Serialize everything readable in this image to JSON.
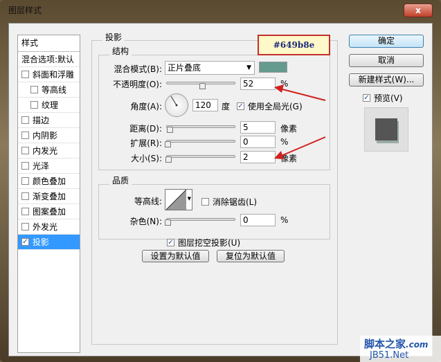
{
  "window": {
    "title": "图层样式",
    "close": "x"
  },
  "sidebar": {
    "header": "样式",
    "items": [
      {
        "label": "混合选项:默认",
        "checkbox": false
      },
      {
        "label": "斜面和浮雕",
        "checkbox": true,
        "checked": false
      },
      {
        "label": "等高线",
        "checkbox": true,
        "checked": false,
        "indent": true
      },
      {
        "label": "纹理",
        "checkbox": true,
        "checked": false,
        "indent": true
      },
      {
        "label": "描边",
        "checkbox": true,
        "checked": false
      },
      {
        "label": "内阴影",
        "checkbox": true,
        "checked": false
      },
      {
        "label": "内发光",
        "checkbox": true,
        "checked": false
      },
      {
        "label": "光泽",
        "checkbox": true,
        "checked": false
      },
      {
        "label": "颜色叠加",
        "checkbox": true,
        "checked": false
      },
      {
        "label": "渐变叠加",
        "checkbox": true,
        "checked": false
      },
      {
        "label": "图案叠加",
        "checkbox": true,
        "checked": false
      },
      {
        "label": "外发光",
        "checkbox": true,
        "checked": false
      },
      {
        "label": "投影",
        "checkbox": true,
        "checked": true,
        "selected": true
      }
    ]
  },
  "panel": {
    "title": "投影",
    "structure": {
      "title": "结构",
      "blend_label": "混合模式(B):",
      "blend_value": "正片叠底",
      "color": "#649b8e",
      "opacity_label": "不透明度(O):",
      "opacity": "52",
      "opacity_unit": "%",
      "angle_label": "角度(A):",
      "angle": "120",
      "angle_unit": "度",
      "global_light": "使用全局光(G)",
      "distance_label": "距离(D):",
      "distance": "5",
      "distance_unit": "像素",
      "spread_label": "扩展(R):",
      "spread": "0",
      "spread_unit": "%",
      "size_label": "大小(S):",
      "size": "2",
      "size_unit": "像素"
    },
    "quality": {
      "title": "品质",
      "contour_label": "等高线:",
      "antialias": "消除锯齿(L)",
      "noise_label": "杂色(N):",
      "noise": "0",
      "noise_unit": "%"
    },
    "knockout": "图层挖空投影(U)",
    "make_default": "设置为默认值",
    "reset_default": "复位为默认值"
  },
  "annotation": {
    "text": "#649b8e"
  },
  "buttons": {
    "ok": "确定",
    "cancel": "取消",
    "new_style": "新建样式(W)...",
    "preview": "预览(V)"
  },
  "watermark": {
    "line1": "脚本之家",
    "line1b": ".com",
    "line2": "JB51.Net"
  }
}
